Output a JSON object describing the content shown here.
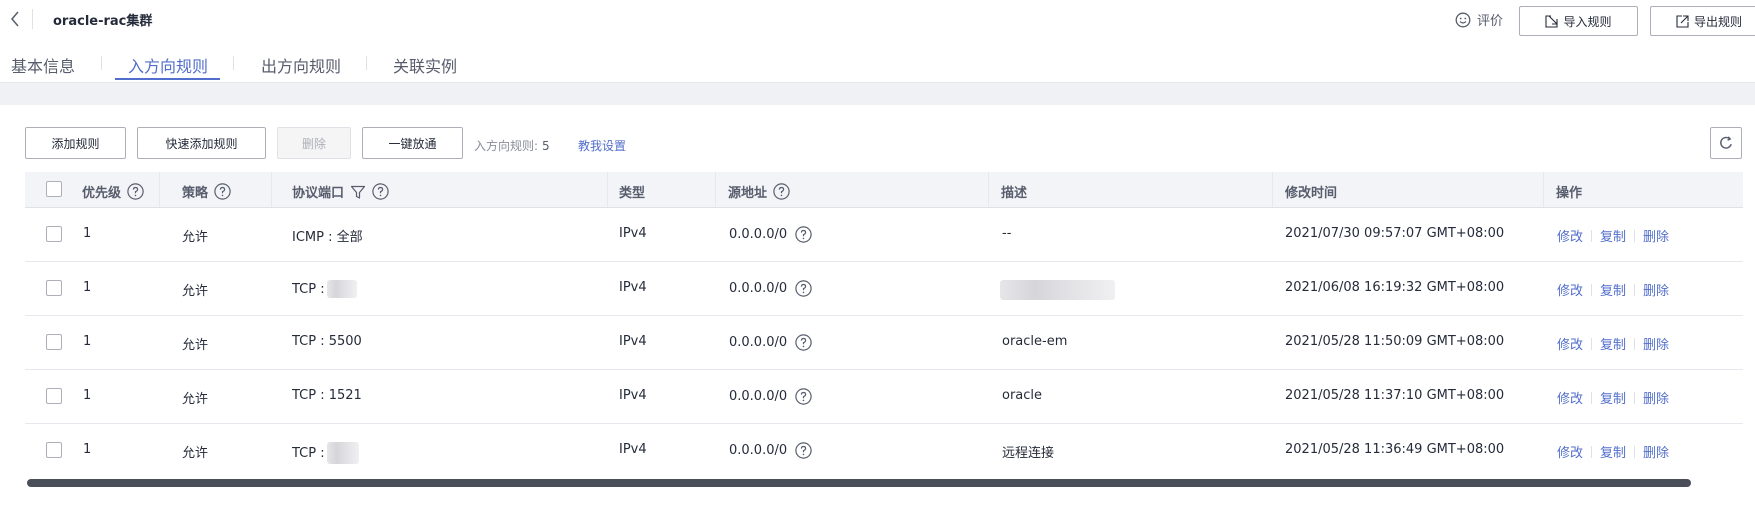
{
  "header": {
    "title": "oracle-rac集群",
    "feedback_label": "评价",
    "import_label": "导入规则",
    "export_label": "导出规则"
  },
  "tabs": [
    {
      "label": "基本信息",
      "active": false
    },
    {
      "label": "入方向规则",
      "active": true
    },
    {
      "label": "出方向规则",
      "active": false
    },
    {
      "label": "关联实例",
      "active": false
    }
  ],
  "toolbar": {
    "add_rule": "添加规则",
    "quick_add": "快速添加规则",
    "delete": "删除",
    "one_click_allow": "一键放通",
    "rule_count_label": "入方向规则:",
    "rule_count": "5",
    "help_link": "教我设置"
  },
  "table": {
    "columns": [
      "优先级",
      "策略",
      "协议端口",
      "类型",
      "源地址",
      "描述",
      "修改时间",
      "操作"
    ],
    "rows": [
      {
        "priority": "1",
        "policy": "允许",
        "protocol_port": "ICMP : 全部",
        "type": "IPv4",
        "source": "0.0.0.0/0",
        "description": "--",
        "modified": "2021/07/30 09:57:07 GMT+08:00"
      },
      {
        "priority": "1",
        "policy": "允许",
        "protocol_port": "TCP :",
        "type": "IPv4",
        "source": "0.0.0.0/0",
        "description": "",
        "modified": "2021/06/08 16:19:32 GMT+08:00"
      },
      {
        "priority": "1",
        "policy": "允许",
        "protocol_port": "TCP : 5500",
        "type": "IPv4",
        "source": "0.0.0.0/0",
        "description": "oracle-em",
        "modified": "2021/05/28 11:50:09 GMT+08:00"
      },
      {
        "priority": "1",
        "policy": "允许",
        "protocol_port": "TCP : 1521",
        "type": "IPv4",
        "source": "0.0.0.0/0",
        "description": "oracle",
        "modified": "2021/05/28 11:37:10 GMT+08:00"
      },
      {
        "priority": "1",
        "policy": "允许",
        "protocol_port": "TCP :",
        "type": "IPv4",
        "source": "0.0.0.0/0",
        "description": "远程连接",
        "modified": "2021/05/28 11:36:49 GMT+08:00"
      }
    ],
    "actions": [
      "修改",
      "复制",
      "删除"
    ]
  },
  "colors": {
    "accent": "#526ecc",
    "text": "#252b3a",
    "header_bg": "#f3f4f7"
  }
}
